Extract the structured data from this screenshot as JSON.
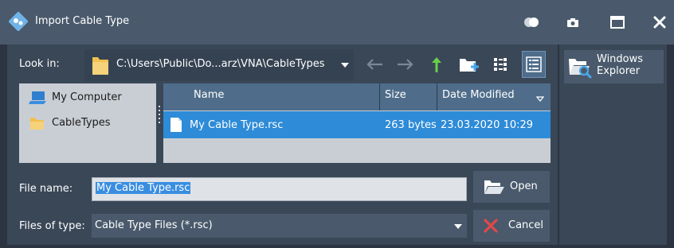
{
  "window": {
    "title": "Import Cable Type"
  },
  "look_in": {
    "label": "Look in:",
    "path": "C:\\Users\\Public\\Do...arz\\VNA\\CableTypes"
  },
  "places": [
    {
      "label": "My Computer",
      "icon": "computer-icon"
    },
    {
      "label": "CableTypes",
      "icon": "folder-icon"
    }
  ],
  "file_list": {
    "columns": [
      "Name",
      "Size",
      "Date Modified"
    ],
    "rows": [
      {
        "name": "My Cable Type.rsc",
        "size": "263 bytes",
        "date_modified": "23.03.2020 10:29",
        "selected": true
      }
    ]
  },
  "file_name": {
    "label": "File name:",
    "value": "My Cable Type.rsc"
  },
  "file_type": {
    "label": "Files of type:",
    "value": "Cable Type Files (*.rsc)"
  },
  "buttons": {
    "open": "Open",
    "cancel": "Cancel",
    "windows_explorer": "Windows Explorer"
  },
  "colors": {
    "titlebar": "#4a5a6c",
    "panel": "#3a4757",
    "selection": "#2e8bd7",
    "column_header": "#4f6d8a",
    "list_background": "#c9ced4",
    "up_arrow": "#66d04a",
    "cancel_x": "#e24848"
  }
}
